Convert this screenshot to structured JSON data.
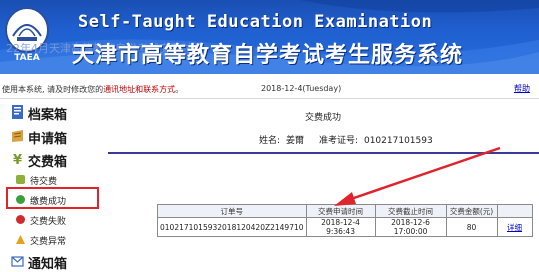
{
  "header": {
    "title_en": "Self-Taught Education Examination",
    "title_cn": "天津市高等教育自学考试考生服务系统",
    "overlay_text": "22年4月天津高等教育自学考试交费时间",
    "logo_text": "TAEA"
  },
  "infobar": {
    "notice_prefix": "使用本系统, 请及时修改您的",
    "notice_red": "通讯地址和联系方式",
    "notice_suffix": "。",
    "date": "2018-12-4(Tuesday)",
    "help": "帮助"
  },
  "sidebar": {
    "sections": [
      {
        "label": "档案箱",
        "icon": "file-box-icon"
      },
      {
        "label": "申请箱",
        "icon": "application-box-icon"
      },
      {
        "label": "交费箱",
        "icon": "fee-box-icon"
      },
      {
        "label": "通知箱",
        "icon": "notice-box-icon"
      }
    ],
    "fee_items": [
      {
        "label": "待交费",
        "icon": "pending-icon"
      },
      {
        "label": "缴费成功",
        "icon": "success-icon"
      },
      {
        "label": "交费失败",
        "icon": "failed-icon"
      },
      {
        "label": "交费异常",
        "icon": "abnormal-icon"
      }
    ]
  },
  "main": {
    "heading": "交费成功",
    "name_label": "姓名:",
    "name_value": "姜爾",
    "id_label": "准考证号:",
    "id_value": "010217101593",
    "table": {
      "headers": [
        "订单号",
        "交费申请时间",
        "交费截止时间",
        "交费金额(元)",
        ""
      ],
      "rows": [
        [
          "0102171015932018120420Z2149710",
          "2018-12-4 9:36:43",
          "2018-12-6 17:00:00",
          "80",
          "详细"
        ]
      ]
    }
  },
  "colors": {
    "banner": "#1f5fcf",
    "highlight": "#e0242c",
    "divider": "#3a3a99",
    "link": "#0000cc"
  }
}
